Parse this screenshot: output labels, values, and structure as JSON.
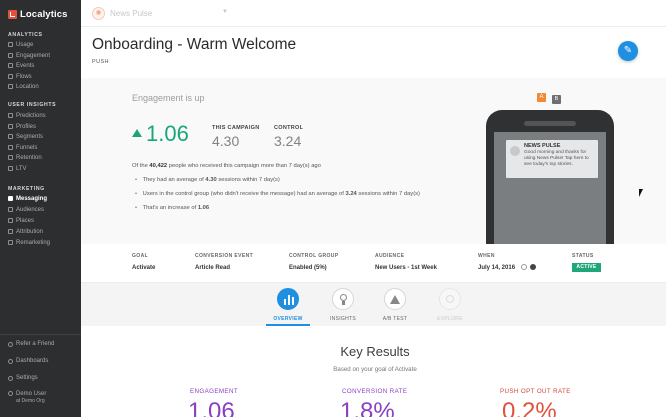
{
  "sidebar": {
    "brand": "Localytics",
    "sections": [
      {
        "heading": "ANALYTICS",
        "items": [
          "Usage",
          "Engagement",
          "Events",
          "Flows",
          "Location"
        ]
      },
      {
        "heading": "USER INSIGHTS",
        "items": [
          "Predictions",
          "Profiles",
          "Segments",
          "Funnels",
          "Retention",
          "LTV"
        ]
      },
      {
        "heading": "MARKETING",
        "items": [
          "Messaging",
          "Audiences",
          "Places",
          "Attribution",
          "Remarketing"
        ]
      }
    ],
    "active_item": "Messaging",
    "footer": {
      "refer": "Refer a Friend",
      "dashboards": "Dashboards",
      "settings": "Settings",
      "user_name": "Demo User",
      "user_org": "at Demo Org"
    }
  },
  "topbar": {
    "app_name": "News Pulse"
  },
  "header": {
    "title": "Onboarding - Warm Welcome",
    "subtitle": "PUSH"
  },
  "engagement": {
    "heading": "Engagement is up",
    "main_value": "1.06",
    "campaign_label": "THIS CAMPAIGN",
    "campaign_value": "4.30",
    "control_label": "CONTROL",
    "control_value": "3.24",
    "desc_prefix": "Of the",
    "desc_count": "40,422",
    "desc_suffix": "people who received this campaign more than 7 day(s) ago",
    "b1_prefix": "They had an average of",
    "b1_value": "4.30",
    "b1_suffix": "sessions within 7 day(s)",
    "b2_prefix": "Users in the control group (who didn't receive the message) had an average of",
    "b2_value": "3.24",
    "b2_suffix": "sessions within 7 day(s)",
    "b3_prefix": "That's an increase of",
    "b3_value": "1.06"
  },
  "phone": {
    "badge_a": "A",
    "badge_b": "B",
    "notif_title": "NEWS PULSE",
    "notif_body": "Good morning and thanks for using News Pulse! Tap here to see today's top stories."
  },
  "summary": {
    "goal_label": "GOAL",
    "goal_value": "Activate",
    "conv_label": "CONVERSION EVENT",
    "conv_value": "Article Read",
    "control_label": "CONTROL GROUP",
    "control_value": "Enabled (5%)",
    "audience_label": "AUDIENCE",
    "audience_value": "New Users - 1st Week",
    "when_label": "WHEN",
    "when_value": "July 14, 2016",
    "status_label": "STATUS",
    "status_value": "ACTIVE"
  },
  "tabs": [
    {
      "label": "OVERVIEW",
      "state": "active"
    },
    {
      "label": "INSIGHTS",
      "state": "normal"
    },
    {
      "label": "A/B TEST",
      "state": "normal"
    },
    {
      "label": "EXPLORE",
      "state": "disabled"
    }
  ],
  "key_results": {
    "title": "Key Results",
    "subtitle": "Based on your goal of Activate",
    "engagement_label": "ENGAGEMENT",
    "engagement_value": "1.06",
    "conversion_label": "CONVERSION RATE",
    "conversion_value": "1.8%",
    "optout_label": "PUSH OPT OUT RATE",
    "optout_value": "0.2%"
  },
  "colors": {
    "accent": "#1e8fe1",
    "positive": "#19a67b",
    "purple": "#8b3fc4",
    "red": "#e2513e",
    "sidebar": "#2d2e2f"
  }
}
